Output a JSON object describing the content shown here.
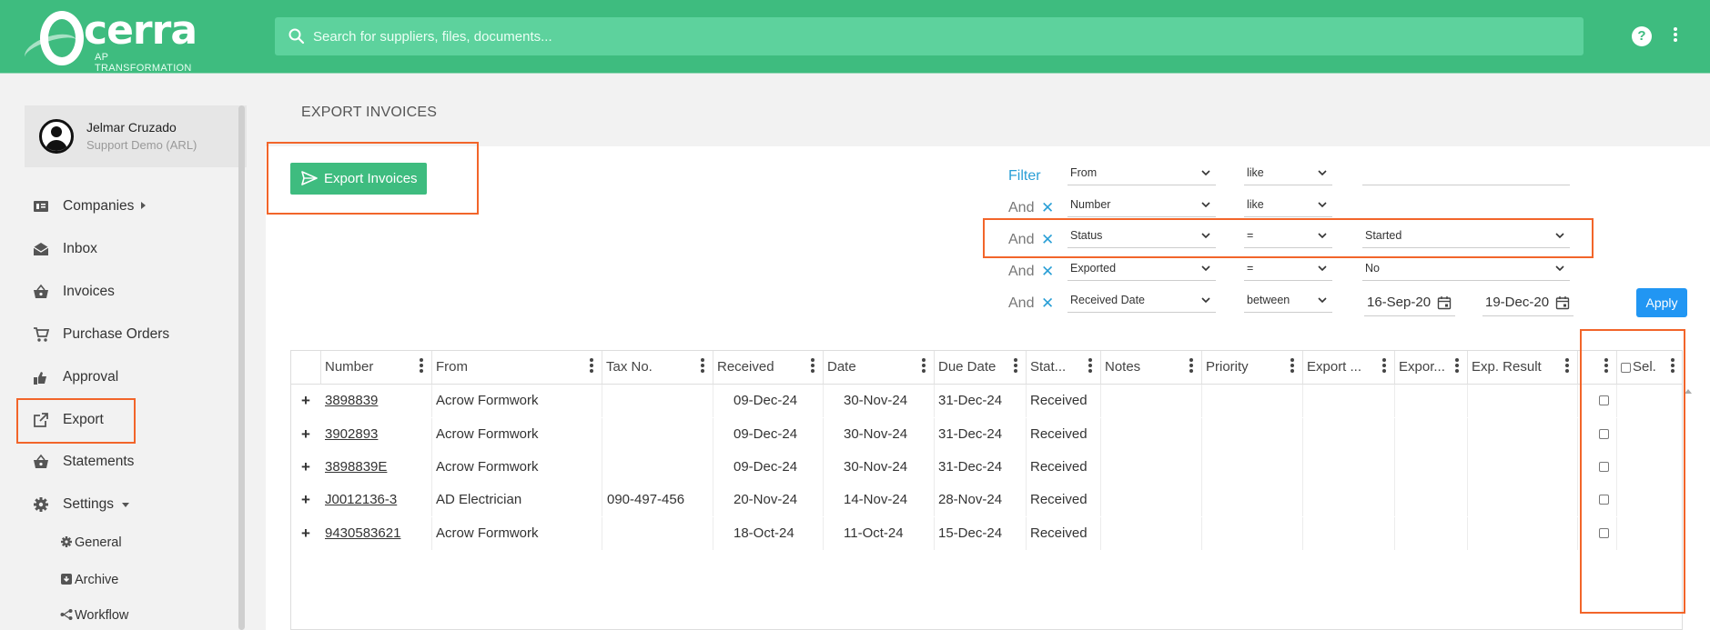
{
  "app": {
    "logo_word": "cerra",
    "logo_tagline": "AP TRANSFORMATION",
    "search_placeholder": "Search for suppliers, files, documents...",
    "help_label": "?"
  },
  "user": {
    "name": "Jelmar Cruzado",
    "role": "Support Demo (ARL)"
  },
  "nav": {
    "companies": "Companies",
    "inbox": "Inbox",
    "invoices": "Invoices",
    "purchase_orders": "Purchase Orders",
    "approval": "Approval",
    "export": "Export",
    "statements": "Statements",
    "settings": "Settings",
    "sub": {
      "general": "General",
      "archive": "Archive",
      "workflow": "Workflow"
    }
  },
  "page": {
    "title": "EXPORT INVOICES",
    "export_button": "Export Invoices"
  },
  "filter": {
    "title": "Filter",
    "and_label": "And",
    "rows": [
      {
        "field": "From",
        "op": "like",
        "value": ""
      },
      {
        "field": "Number",
        "op": "like",
        "value": ""
      },
      {
        "field": "Status",
        "op": "=",
        "value": "Started"
      },
      {
        "field": "Exported",
        "op": "=",
        "value": "No"
      },
      {
        "field": "Received Date",
        "op": "between",
        "value": "16-Sep-20",
        "value2": "19-Dec-20"
      }
    ],
    "apply_label": "Apply"
  },
  "grid": {
    "columns": [
      "Number",
      "From",
      "Tax No.",
      "Received",
      "Date",
      "Due Date",
      "Stat...",
      "Notes",
      "Priority",
      "Export ...",
      "Expor...",
      "Exp. Result",
      "",
      "Sel."
    ],
    "rows": [
      {
        "number": "3898839",
        "from": "Acrow Formwork",
        "tax": "",
        "received": "09-Dec-24",
        "date": "30-Nov-24",
        "due": "31-Dec-24",
        "status": "Received"
      },
      {
        "number": "3902893",
        "from": "Acrow Formwork",
        "tax": "",
        "received": "09-Dec-24",
        "date": "30-Nov-24",
        "due": "31-Dec-24",
        "status": "Received"
      },
      {
        "number": "3898839E",
        "from": "Acrow Formwork",
        "tax": "",
        "received": "09-Dec-24",
        "date": "30-Nov-24",
        "due": "31-Dec-24",
        "status": "Received"
      },
      {
        "number": "J0012136-3",
        "from": "AD Electrician",
        "tax": "090-497-456",
        "received": "20-Nov-24",
        "date": "14-Nov-24",
        "due": "28-Nov-24",
        "status": "Received"
      },
      {
        "number": "9430583621",
        "from": "Acrow Formwork",
        "tax": "",
        "received": "18-Oct-24",
        "date": "11-Oct-24",
        "due": "15-Dec-24",
        "status": "Received"
      }
    ],
    "expand_symbol": "+"
  },
  "colors": {
    "brand": "#3ebc7f",
    "accent": "#2196f3",
    "highlight": "#f2652a"
  }
}
